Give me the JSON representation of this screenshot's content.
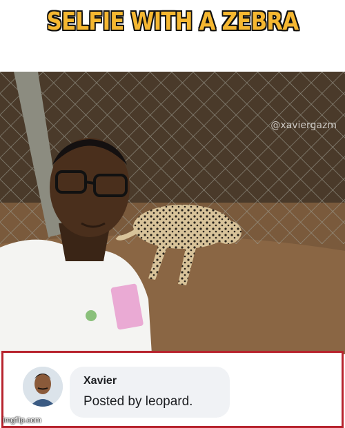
{
  "meme": {
    "title": "SELFIE WITH A ZEBRA",
    "watermark": "@xaviergazm",
    "site_tag": "imgflip.com",
    "title_color": "#f5b731"
  },
  "comment": {
    "author": "Xavier",
    "text": "Posted by leopard.",
    "border_color": "#b7232d"
  }
}
